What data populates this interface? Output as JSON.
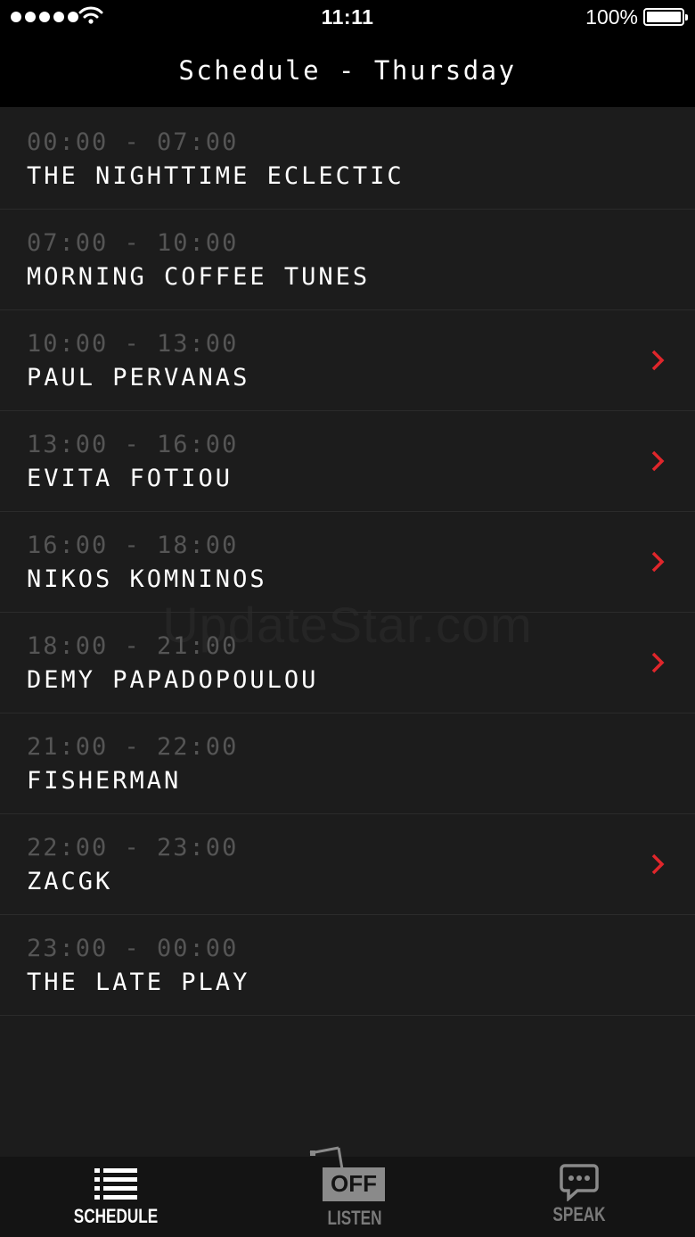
{
  "status_bar": {
    "time": "11:11",
    "battery_percent": "100%",
    "signal_icon": "signal-dots-icon",
    "wifi_icon": "wifi-icon",
    "battery_icon": "battery-icon",
    "battery_level": 1.0
  },
  "header": {
    "title": "Schedule - Thursday"
  },
  "schedule": [
    {
      "slot": "00:00 - 07:00",
      "show": "THE NIGHTTIME ECLECTIC",
      "has_details": false
    },
    {
      "slot": "07:00 - 10:00",
      "show": "MORNING COFFEE TUNES",
      "has_details": false
    },
    {
      "slot": "10:00 - 13:00",
      "show": "PAUL PERVANAS",
      "has_details": true
    },
    {
      "slot": "13:00 - 16:00",
      "show": "EVITA FOTIOU",
      "has_details": true
    },
    {
      "slot": "16:00 - 18:00",
      "show": "NIKOS KOMNINOS",
      "has_details": true
    },
    {
      "slot": "18:00 - 21:00",
      "show": "DEMY PAPADOPOULOU",
      "has_details": true
    },
    {
      "slot": "21:00 - 22:00",
      "show": "FISHERMAN",
      "has_details": false
    },
    {
      "slot": "22:00 - 23:00",
      "show": "ZACGK",
      "has_details": true
    },
    {
      "slot": "23:00 - 00:00",
      "show": "THE LATE PLAY",
      "has_details": false
    }
  ],
  "watermark": "UpdateStar.com",
  "tabbar": {
    "schedule": {
      "label": "SCHEDULE",
      "icon": "list-icon",
      "active": true
    },
    "listen": {
      "label": "LISTEN",
      "icon": "radio-off-icon",
      "badge": "OFF",
      "active": false
    },
    "speak": {
      "label": "SPEAK",
      "icon": "chat-bubble-icon",
      "active": false
    }
  },
  "colors": {
    "background": "#1c1c1c",
    "header": "#000000",
    "accent_chevron": "#e0262b",
    "slot_text": "#555555",
    "show_text": "#ffffff",
    "tab_inactive": "#7a7a7a"
  }
}
